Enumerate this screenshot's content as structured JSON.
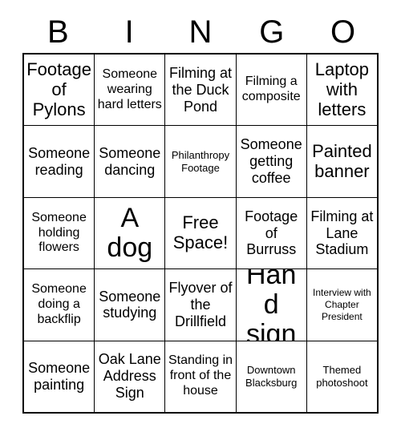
{
  "card": {
    "header_letters": [
      "B",
      "I",
      "N",
      "G",
      "O"
    ],
    "columns": 5,
    "rows": 5,
    "background_color": "#ffffff",
    "border_color": "#000000",
    "text_color": "#000000",
    "cells": [
      {
        "text": "Footage of Pylons",
        "size": "lg",
        "free_space": false
      },
      {
        "text": "Someone wearing hard letters",
        "size": "sm",
        "free_space": false
      },
      {
        "text": "Filming at the Duck Pond",
        "size": "md",
        "free_space": false
      },
      {
        "text": "Filming a composite",
        "size": "sm",
        "free_space": false
      },
      {
        "text": "Laptop with letters",
        "size": "lg",
        "free_space": false
      },
      {
        "text": "Someone reading",
        "size": "md",
        "free_space": false
      },
      {
        "text": "Someone dancing",
        "size": "md",
        "free_space": false
      },
      {
        "text": "Philanthropy Footage",
        "size": "xs",
        "free_space": false
      },
      {
        "text": "Someone getting coffee",
        "size": "md",
        "free_space": false
      },
      {
        "text": "Painted banner",
        "size": "lg",
        "free_space": false
      },
      {
        "text": "Someone holding flowers",
        "size": "sm",
        "free_space": false
      },
      {
        "text": "A dog",
        "size": "xl",
        "free_space": false
      },
      {
        "text": "Free Space!",
        "size": "lg",
        "free_space": true
      },
      {
        "text": "Footage of Burruss",
        "size": "md",
        "free_space": false
      },
      {
        "text": "Filming at Lane Stadium",
        "size": "md",
        "free_space": false
      },
      {
        "text": "Someone doing a backflip",
        "size": "sm",
        "free_space": false
      },
      {
        "text": "Someone studying",
        "size": "md",
        "free_space": false
      },
      {
        "text": "Flyover of the Drillfield",
        "size": "md",
        "free_space": false
      },
      {
        "text": "Hand sign",
        "size": "xl",
        "free_space": false
      },
      {
        "text": "Interview with Chapter President",
        "size": "xxs",
        "free_space": false
      },
      {
        "text": "Someone painting",
        "size": "md",
        "free_space": false
      },
      {
        "text": "Oak Lane Address Sign",
        "size": "md",
        "free_space": false
      },
      {
        "text": "Standing in front of the house",
        "size": "sm",
        "free_space": false
      },
      {
        "text": "Downtown Blacksburg",
        "size": "xs",
        "free_space": false
      },
      {
        "text": "Themed photoshoot",
        "size": "xs",
        "free_space": false
      }
    ]
  }
}
